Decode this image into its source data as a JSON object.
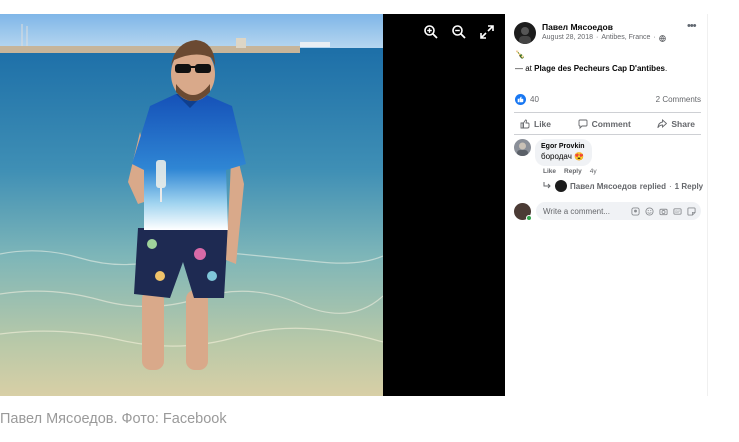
{
  "toolbar": {
    "zoom_in_icon": "zoom-in-icon",
    "zoom_out_icon": "zoom-out-icon",
    "fullscreen_icon": "fullscreen-icon"
  },
  "post": {
    "author": "Павел Мясоедов",
    "date": "August 28, 2018",
    "location": "Antibes, France",
    "separator": "·",
    "emoji": "🍾",
    "checkin_prefix": "— at ",
    "checkin_place": "Plage des Pecheurs Cap D'antibes",
    "checkin_suffix": ".",
    "reaction_count": "40",
    "comment_count": "2 Comments"
  },
  "actions": {
    "like": "Like",
    "comment": "Comment",
    "share": "Share"
  },
  "comment": {
    "author": "Egor Provkin",
    "text": "бородач",
    "emoji": "😍",
    "like": "Like",
    "reply": "Reply",
    "time": "4y",
    "reply_summary_name": "Павел Мясоедов",
    "reply_summary_text": "replied",
    "reply_summary_count": "1 Reply",
    "reply_summary_sep": "·"
  },
  "composer": {
    "placeholder": "Write a comment..."
  },
  "caption": "Павел Мясоедов. Фото: Facebook",
  "colors": {
    "accent": "#1877f2",
    "online": "#31a24c",
    "caption": "#9a9a9a"
  }
}
